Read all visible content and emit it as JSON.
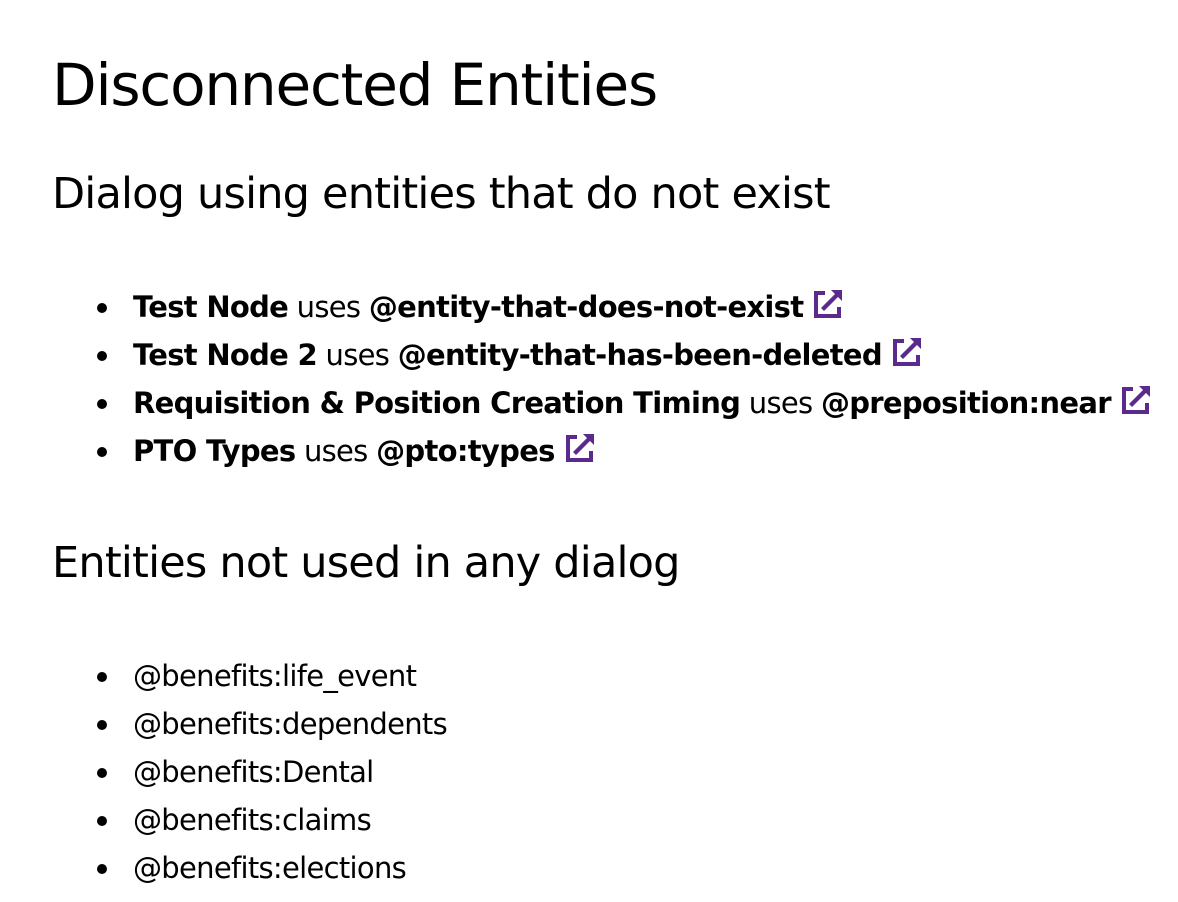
{
  "page_title": "Disconnected Entities",
  "link_icon_color": "#5a2a8c",
  "sections": {
    "dialog_missing": {
      "heading": "Dialog using entities that do not exist",
      "items": [
        {
          "node": "Test Node",
          "connector": "uses",
          "entity": "@entity-that-does-not-exist",
          "icon": "external-link-icon"
        },
        {
          "node": "Test Node 2",
          "connector": "uses",
          "entity": "@entity-that-has-been-deleted",
          "icon": "external-link-icon"
        },
        {
          "node": "Requisition & Position Creation Timing",
          "connector": "uses",
          "entity": "@preposition:near",
          "icon": "external-link-icon"
        },
        {
          "node": "PTO Types",
          "connector": "uses",
          "entity": "@pto:types",
          "icon": "external-link-icon"
        }
      ]
    },
    "unused": {
      "heading": "Entities not used in any dialog",
      "items": [
        "@benefits:life_event",
        "@benefits:dependents",
        "@benefits:Dental",
        "@benefits:claims",
        "@benefits:elections"
      ]
    }
  }
}
